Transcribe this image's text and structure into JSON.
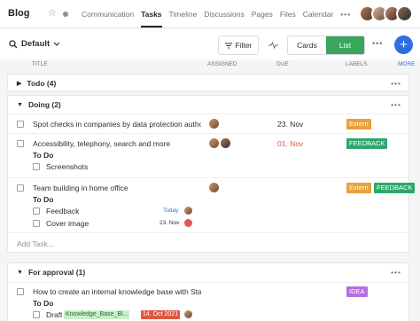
{
  "header": {
    "title": "Blog",
    "nav": [
      "Communication",
      "Tasks",
      "Timeline",
      "Discussions",
      "Pages",
      "Files",
      "Calendar"
    ],
    "nav_more": "•••"
  },
  "toolbar": {
    "view": "Default",
    "filter_label": "Filter",
    "cards_label": "Cards",
    "list_label": "List",
    "more": "•••",
    "add": "+"
  },
  "columns": {
    "title": "TITLE",
    "assigned": "ASSIGNED",
    "due": "DUE",
    "labels": "LABELS",
    "more": "MORE"
  },
  "groups": {
    "todo": {
      "name": "Todo (4)",
      "more": "•••"
    },
    "doing": {
      "name": "Doing (2)",
      "more": "•••",
      "tasks": [
        {
          "title": "Spot checks in companies by data protection author",
          "due": "23. Nov",
          "label": "Extern"
        },
        {
          "title": "Accessibility, telephony, search and more",
          "due": "01. Nov",
          "label": "FEEDBACK",
          "subhead": "To Do",
          "sub": [
            {
              "title": "Screenshots"
            }
          ]
        },
        {
          "title": "Team building in home office",
          "labels": [
            "Extern",
            "FEEDBACK"
          ],
          "subhead": "To Do",
          "sub": [
            {
              "title": "Feedback",
              "due": "Today"
            },
            {
              "title": "Cover image",
              "due": "23. Nov"
            }
          ]
        }
      ],
      "add_task": "Add Task..."
    },
    "approval": {
      "name": "For approval (1)",
      "more": "•••",
      "tasks": [
        {
          "title": "How to create an internal knowledge base with Stac",
          "label": "IDEA",
          "subhead": "To Do",
          "sub": [
            {
              "title": "Draft",
              "tag": "Knowledge_Base_Bl...",
              "date": "14. Oct 2021"
            }
          ]
        }
      ]
    }
  },
  "colors": {
    "accent": "#2f6ee2",
    "list_active": "#3aa55d",
    "extern": "#e8a13a",
    "feedback": "#2ea86a",
    "idea": "#b76fe0",
    "late": "#e0563f"
  }
}
